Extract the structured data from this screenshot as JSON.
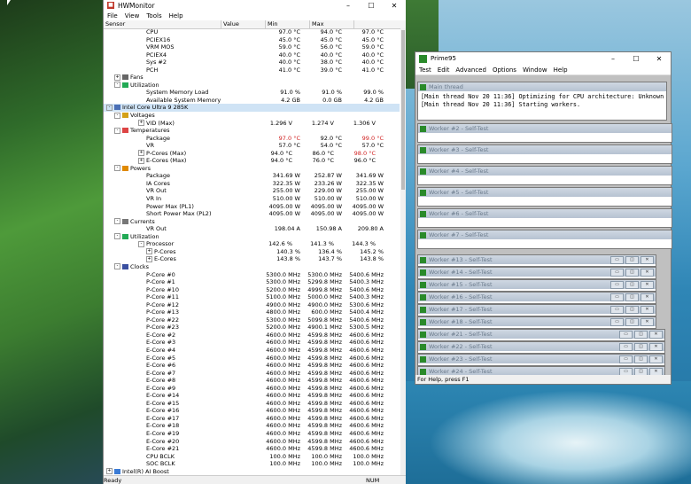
{
  "hwmonitor": {
    "title": "HWMonitor",
    "menu": [
      "File",
      "View",
      "Tools",
      "Help"
    ],
    "columns": [
      "Sensor",
      "Value",
      "Min",
      "Max"
    ],
    "status_left": "Ready",
    "status_num": "NUM",
    "rows": [
      {
        "indent": 5,
        "name": "CPU",
        "v": "97.0 °C",
        "min": "94.0 °C",
        "max": "97.0 °C"
      },
      {
        "indent": 5,
        "name": "PCIEX16",
        "v": "45.0 °C",
        "min": "45.0 °C",
        "max": "45.0 °C"
      },
      {
        "indent": 5,
        "name": "VRM MOS",
        "v": "59.0 °C",
        "min": "56.0 °C",
        "max": "59.0 °C"
      },
      {
        "indent": 5,
        "name": "PCIEX4",
        "v": "40.0 °C",
        "min": "40.0 °C",
        "max": "40.0 °C"
      },
      {
        "indent": 5,
        "name": "Sys #2",
        "v": "40.0 °C",
        "min": "38.0 °C",
        "max": "40.0 °C"
      },
      {
        "indent": 5,
        "name": "PCH",
        "v": "41.0 °C",
        "min": "39.0 °C",
        "max": "41.0 °C"
      },
      {
        "indent": 2,
        "name": "Fans",
        "v": "",
        "min": "",
        "max": "",
        "exp": "+",
        "icon": "fan"
      },
      {
        "indent": 2,
        "name": "Utilization",
        "v": "",
        "min": "",
        "max": "",
        "exp": "-",
        "icon": "util"
      },
      {
        "indent": 5,
        "name": "System Memory Load",
        "v": "91.0 %",
        "min": "91.0 %",
        "max": "99.0 %"
      },
      {
        "indent": 5,
        "name": "Available System Memory",
        "v": "4.2 GB",
        "min": "0.0 GB",
        "max": "4.2 GB"
      },
      {
        "indent": 1,
        "name": "Intel Core Ultra 9 285K",
        "v": "",
        "min": "",
        "max": "",
        "exp": "-",
        "icon": "chip",
        "sel": true
      },
      {
        "indent": 2,
        "name": "Voltages",
        "v": "",
        "min": "",
        "max": "",
        "exp": "-",
        "icon": "volt"
      },
      {
        "indent": 5,
        "name": "VID (Max)",
        "v": "1.296 V",
        "min": "1.274 V",
        "max": "1.306 V",
        "exp": "+"
      },
      {
        "indent": 2,
        "name": "Temperatures",
        "v": "",
        "min": "",
        "max": "",
        "exp": "-",
        "icon": "temp"
      },
      {
        "indent": 5,
        "name": "Package",
        "v": "97.0 °C",
        "min": "92.0 °C",
        "max": "99.0 °C",
        "red": true
      },
      {
        "indent": 5,
        "name": "VR",
        "v": "57.0 °C",
        "min": "54.0 °C",
        "max": "57.0 °C"
      },
      {
        "indent": 5,
        "name": "P-Cores (Max)",
        "v": "94.0 °C",
        "min": "86.0 °C",
        "max": "98.0 °C",
        "exp": "+",
        "redmax": true
      },
      {
        "indent": 5,
        "name": "E-Cores (Max)",
        "v": "94.0 °C",
        "min": "76.0 °C",
        "max": "96.0 °C",
        "exp": "+"
      },
      {
        "indent": 2,
        "name": "Powers",
        "v": "",
        "min": "",
        "max": "",
        "exp": "-",
        "icon": "power"
      },
      {
        "indent": 5,
        "name": "Package",
        "v": "341.69 W",
        "min": "252.87 W",
        "max": "341.69 W"
      },
      {
        "indent": 5,
        "name": "IA Cores",
        "v": "322.35 W",
        "min": "233.26 W",
        "max": "322.35 W"
      },
      {
        "indent": 5,
        "name": "VR Out",
        "v": "255.00 W",
        "min": "229.00 W",
        "max": "255.00 W"
      },
      {
        "indent": 5,
        "name": "VR In",
        "v": "510.00 W",
        "min": "510.00 W",
        "max": "510.00 W"
      },
      {
        "indent": 5,
        "name": "Power Max (PL1)",
        "v": "4095.00 W",
        "min": "4095.00 W",
        "max": "4095.00 W"
      },
      {
        "indent": 5,
        "name": "Short Power Max (PL2)",
        "v": "4095.00 W",
        "min": "4095.00 W",
        "max": "4095.00 W"
      },
      {
        "indent": 2,
        "name": "Currents",
        "v": "",
        "min": "",
        "max": "",
        "exp": "-",
        "icon": "current"
      },
      {
        "indent": 5,
        "name": "VR Out",
        "v": "198.04 A",
        "min": "150.98 A",
        "max": "209.80 A"
      },
      {
        "indent": 2,
        "name": "Utilization",
        "v": "",
        "min": "",
        "max": "",
        "exp": "-",
        "icon": "util"
      },
      {
        "indent": 5,
        "name": "Processor",
        "v": "142.6 %",
        "min": "141.3 %",
        "max": "144.3 %",
        "exp": "-"
      },
      {
        "indent": 6,
        "name": "P-Cores",
        "v": "140.3 %",
        "min": "136.4 %",
        "max": "145.2 %",
        "exp": "+"
      },
      {
        "indent": 6,
        "name": "E-Cores",
        "v": "143.8 %",
        "min": "143.7 %",
        "max": "143.8 %",
        "exp": "+"
      },
      {
        "indent": 2,
        "name": "Clocks",
        "v": "",
        "min": "",
        "max": "",
        "exp": "-",
        "icon": "clock"
      },
      {
        "indent": 5,
        "name": "P-Core #0",
        "v": "5300.0 MHz",
        "min": "5300.0 MHz",
        "max": "5400.6 MHz"
      },
      {
        "indent": 5,
        "name": "P-Core #1",
        "v": "5300.0 MHz",
        "min": "5299.8 MHz",
        "max": "5400.3 MHz"
      },
      {
        "indent": 5,
        "name": "P-Core #10",
        "v": "5200.0 MHz",
        "min": "4999.8 MHz",
        "max": "5400.6 MHz"
      },
      {
        "indent": 5,
        "name": "P-Core #11",
        "v": "5100.0 MHz",
        "min": "5000.0 MHz",
        "max": "5400.3 MHz"
      },
      {
        "indent": 5,
        "name": "P-Core #12",
        "v": "4900.0 MHz",
        "min": "4900.0 MHz",
        "max": "5300.6 MHz"
      },
      {
        "indent": 5,
        "name": "P-Core #13",
        "v": "4800.0 MHz",
        "min": "600.0 MHz",
        "max": "5400.4 MHz"
      },
      {
        "indent": 5,
        "name": "P-Core #22",
        "v": "5300.0 MHz",
        "min": "5099.8 MHz",
        "max": "5400.6 MHz"
      },
      {
        "indent": 5,
        "name": "P-Core #23",
        "v": "5200.0 MHz",
        "min": "4900.1 MHz",
        "max": "5300.5 MHz"
      },
      {
        "indent": 5,
        "name": "E-Core #2",
        "v": "4600.0 MHz",
        "min": "4599.8 MHz",
        "max": "4600.6 MHz"
      },
      {
        "indent": 5,
        "name": "E-Core #3",
        "v": "4600.0 MHz",
        "min": "4599.8 MHz",
        "max": "4600.6 MHz"
      },
      {
        "indent": 5,
        "name": "E-Core #4",
        "v": "4600.0 MHz",
        "min": "4599.8 MHz",
        "max": "4600.6 MHz"
      },
      {
        "indent": 5,
        "name": "E-Core #5",
        "v": "4600.0 MHz",
        "min": "4599.8 MHz",
        "max": "4600.6 MHz"
      },
      {
        "indent": 5,
        "name": "E-Core #6",
        "v": "4600.0 MHz",
        "min": "4599.8 MHz",
        "max": "4600.6 MHz"
      },
      {
        "indent": 5,
        "name": "E-Core #7",
        "v": "4600.0 MHz",
        "min": "4599.8 MHz",
        "max": "4600.6 MHz"
      },
      {
        "indent": 5,
        "name": "E-Core #8",
        "v": "4600.0 MHz",
        "min": "4599.8 MHz",
        "max": "4600.6 MHz"
      },
      {
        "indent": 5,
        "name": "E-Core #9",
        "v": "4600.0 MHz",
        "min": "4599.8 MHz",
        "max": "4600.6 MHz"
      },
      {
        "indent": 5,
        "name": "E-Core #14",
        "v": "4600.0 MHz",
        "min": "4599.8 MHz",
        "max": "4600.6 MHz"
      },
      {
        "indent": 5,
        "name": "E-Core #15",
        "v": "4600.0 MHz",
        "min": "4599.8 MHz",
        "max": "4600.6 MHz"
      },
      {
        "indent": 5,
        "name": "E-Core #16",
        "v": "4600.0 MHz",
        "min": "4599.8 MHz",
        "max": "4600.6 MHz"
      },
      {
        "indent": 5,
        "name": "E-Core #17",
        "v": "4600.0 MHz",
        "min": "4599.8 MHz",
        "max": "4600.6 MHz"
      },
      {
        "indent": 5,
        "name": "E-Core #18",
        "v": "4600.0 MHz",
        "min": "4599.8 MHz",
        "max": "4600.6 MHz"
      },
      {
        "indent": 5,
        "name": "E-Core #19",
        "v": "4600.0 MHz",
        "min": "4599.8 MHz",
        "max": "4600.6 MHz"
      },
      {
        "indent": 5,
        "name": "E-Core #20",
        "v": "4600.0 MHz",
        "min": "4599.8 MHz",
        "max": "4600.6 MHz"
      },
      {
        "indent": 5,
        "name": "E-Core #21",
        "v": "4600.0 MHz",
        "min": "4599.8 MHz",
        "max": "4600.6 MHz"
      },
      {
        "indent": 5,
        "name": "CPU BCLK",
        "v": "100.0 MHz",
        "min": "100.0 MHz",
        "max": "100.0 MHz"
      },
      {
        "indent": 5,
        "name": "SOC BCLK",
        "v": "100.0 MHz",
        "min": "100.0 MHz",
        "max": "100.0 MHz"
      },
      {
        "indent": 1,
        "name": "Intel(R) AI Boost",
        "v": "",
        "min": "",
        "max": "",
        "exp": "+",
        "icon": "chip2"
      }
    ]
  },
  "prime95": {
    "title": "Prime95",
    "menu": [
      "Test",
      "Edit",
      "Advanced",
      "Options",
      "Window",
      "Help"
    ],
    "status": "For Help, press F1",
    "main_title": "Main thread",
    "main_lines": [
      "[Main thread Nov 20 11:36] Optimizing for CPU architecture: Unknown Intel, L2",
      "[Main thread Nov 20 11:36] Starting workers."
    ],
    "workers": [
      "Worker #2 - Self-Test",
      "Worker #3 - Self-Test",
      "Worker #4 - Self-Test",
      "Worker #5 - Self-Test",
      "Worker #6 - Self-Test",
      "Worker #7 - Self-Test",
      "Worker #13 - Self-Test",
      "Worker #14 - Self-Test",
      "Worker #15 - Self-Test",
      "Worker #16 - Self-Test",
      "Worker #17 - Self-Test",
      "Worker #18 - Self-Test",
      "Worker #21 - Self-Test",
      "Worker #22 - Self-Test",
      "Worker #23 - Self-Test",
      "Worker #24 - Self-Test"
    ]
  }
}
